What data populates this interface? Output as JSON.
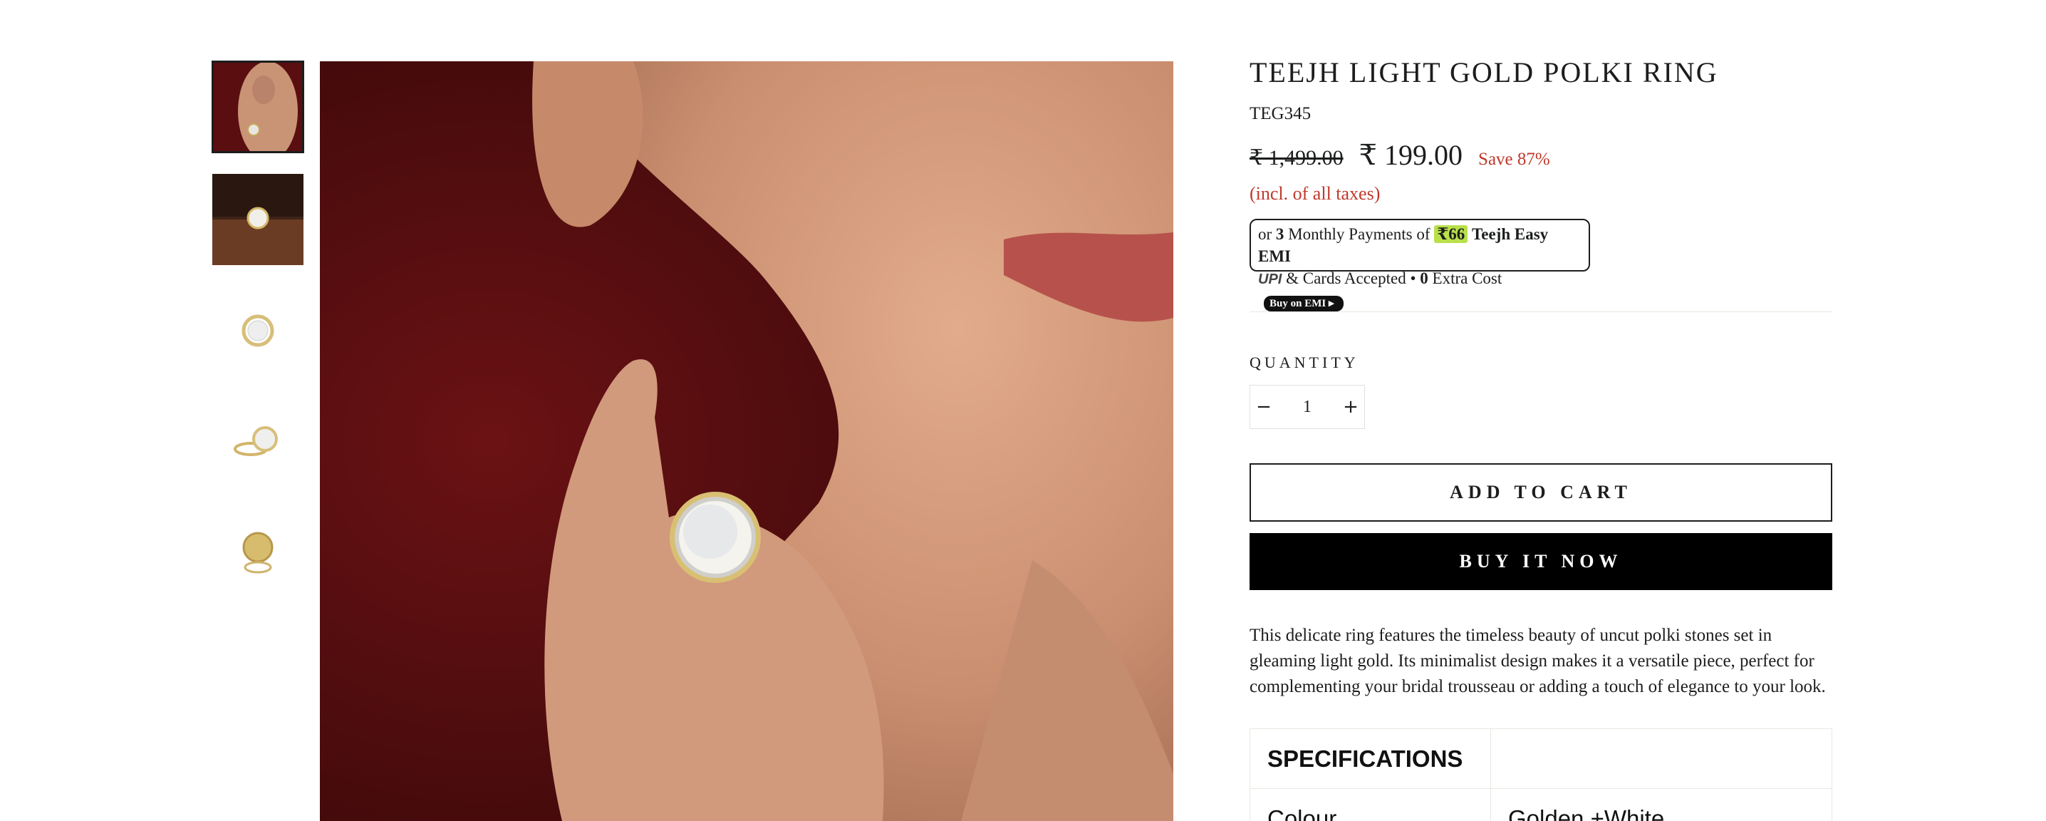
{
  "product": {
    "title": "TEEJH LIGHT GOLD POLKI RING",
    "sku": "TEG345",
    "compare_price": "₹ 1,499.00",
    "price": "₹ 199.00",
    "save": "Save 87%",
    "taxes_note": "(incl. of all taxes)",
    "description": "This delicate ring features the timeless beauty of uncut polki stones set in gleaming light gold. Its minimalist design makes it a versatile piece, perfect for complementing your bridal trousseau or adding a touch of elegance to your look."
  },
  "emi": {
    "prefix": "or",
    "count": "3",
    "mid": "Monthly Payments of",
    "amount": "₹66",
    "brand": "Teejh Easy EMI",
    "upi": "UPI",
    "cards": "& Cards Accepted •",
    "zero": "0",
    "extra": "Extra Cost",
    "buy_label": "Buy on EMI"
  },
  "quantity": {
    "label": "QUANTITY",
    "minus": "−",
    "value": "1",
    "plus": "+"
  },
  "buttons": {
    "add_to_cart": "ADD TO CART",
    "buy_now": "BUY IT NOW"
  },
  "specs": {
    "heading": "SPECIFICATIONS",
    "rows": [
      {
        "key": "Colour",
        "value": "Golden +White"
      }
    ]
  },
  "colors": {
    "accent_red": "#c0392b",
    "emi_highlight": "#b8e04a",
    "background_drape": "#4a0a0c"
  }
}
